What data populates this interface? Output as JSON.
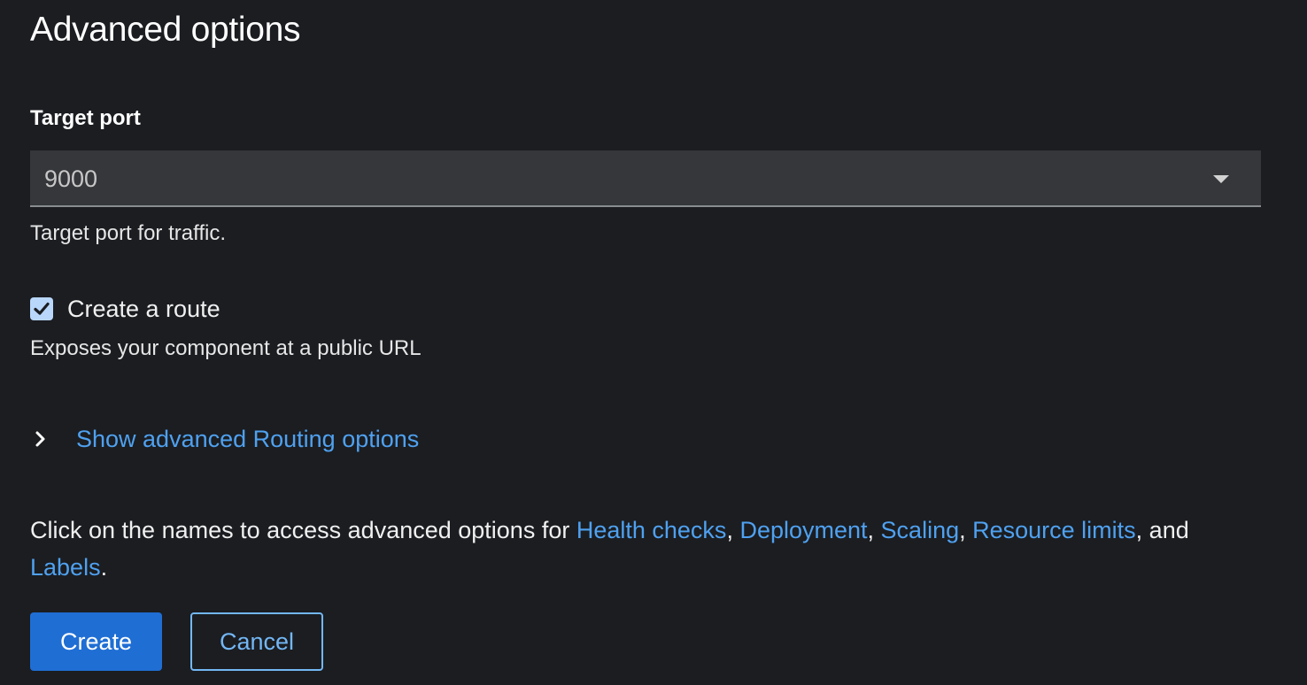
{
  "section": {
    "title": "Advanced options"
  },
  "target_port": {
    "label": "Target port",
    "value": "9000",
    "helper": "Target port for traffic."
  },
  "route": {
    "checkbox_label": "Create a route",
    "checked": true,
    "description": "Exposes your component at a public URL"
  },
  "routing_expander": {
    "label": "Show advanced Routing options"
  },
  "info": {
    "prefix": "Click on the names to access advanced options for ",
    "links": {
      "health_checks": "Health checks",
      "deployment": "Deployment",
      "scaling": "Scaling",
      "resource_limits": "Resource limits",
      "labels": "Labels"
    },
    "sep1": ", ",
    "sep2": ", ",
    "sep3": ", ",
    "and": ", and ",
    "end": "."
  },
  "actions": {
    "create_label": "Create",
    "cancel_label": "Cancel"
  },
  "colors": {
    "background": "#1b1d21",
    "link": "#4fa1f0",
    "primary": "#1f6ed4",
    "checkbox": "#b9d7fb"
  }
}
